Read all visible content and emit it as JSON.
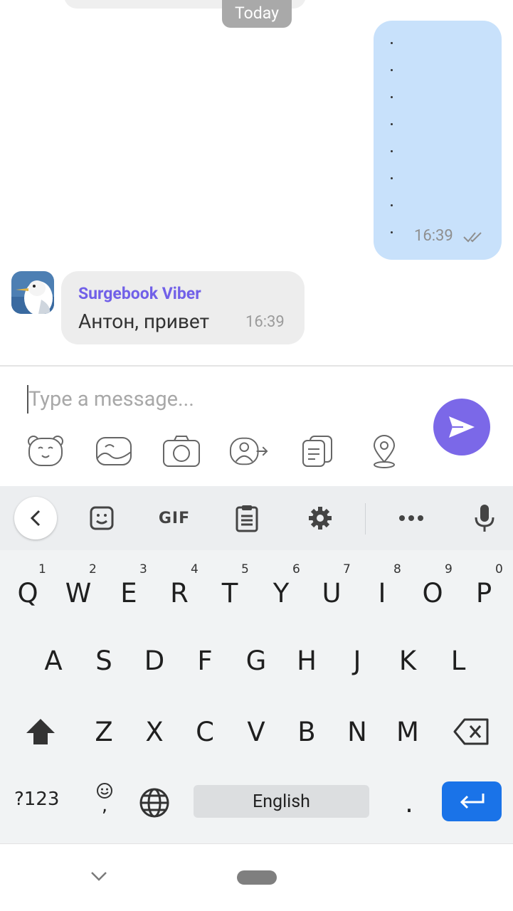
{
  "chat": {
    "date_chip": "Today",
    "outgoing": {
      "text_lines": [
        ".",
        ".",
        ".",
        ".",
        ".",
        ".",
        ".",
        "."
      ],
      "time": "16:39",
      "status": "read-double-check"
    },
    "incoming": {
      "sender": "Surgebook Viber",
      "text": "Антон, привет",
      "time": "16:39"
    }
  },
  "composer": {
    "placeholder": "Type a message...",
    "tools": [
      "sticker-icon",
      "gallery-icon",
      "camera-icon",
      "share-contact-icon",
      "file-icon",
      "location-icon"
    ],
    "send_icon": "send-icon",
    "accent": "#7b68e8"
  },
  "keyboard": {
    "toolbar": [
      "back-icon",
      "sticker-icon",
      "GIF",
      "clipboard-icon",
      "settings-icon",
      "more-icon",
      "microphone-icon"
    ],
    "gif_label": "GIF",
    "row1": [
      {
        "k": "Q",
        "h": "1"
      },
      {
        "k": "W",
        "h": "2"
      },
      {
        "k": "E",
        "h": "3"
      },
      {
        "k": "R",
        "h": "4"
      },
      {
        "k": "T",
        "h": "5"
      },
      {
        "k": "Y",
        "h": "6"
      },
      {
        "k": "U",
        "h": "7"
      },
      {
        "k": "I",
        "h": "8"
      },
      {
        "k": "O",
        "h": "9"
      },
      {
        "k": "P",
        "h": "0"
      }
    ],
    "row2": [
      "A",
      "S",
      "D",
      "F",
      "G",
      "H",
      "J",
      "K",
      "L"
    ],
    "row3": [
      "Z",
      "X",
      "C",
      "V",
      "B",
      "N",
      "M"
    ],
    "mode_label": "?123",
    "comma": ",",
    "space_label": "English",
    "period": ".",
    "enter_color": "#1a73e8"
  }
}
